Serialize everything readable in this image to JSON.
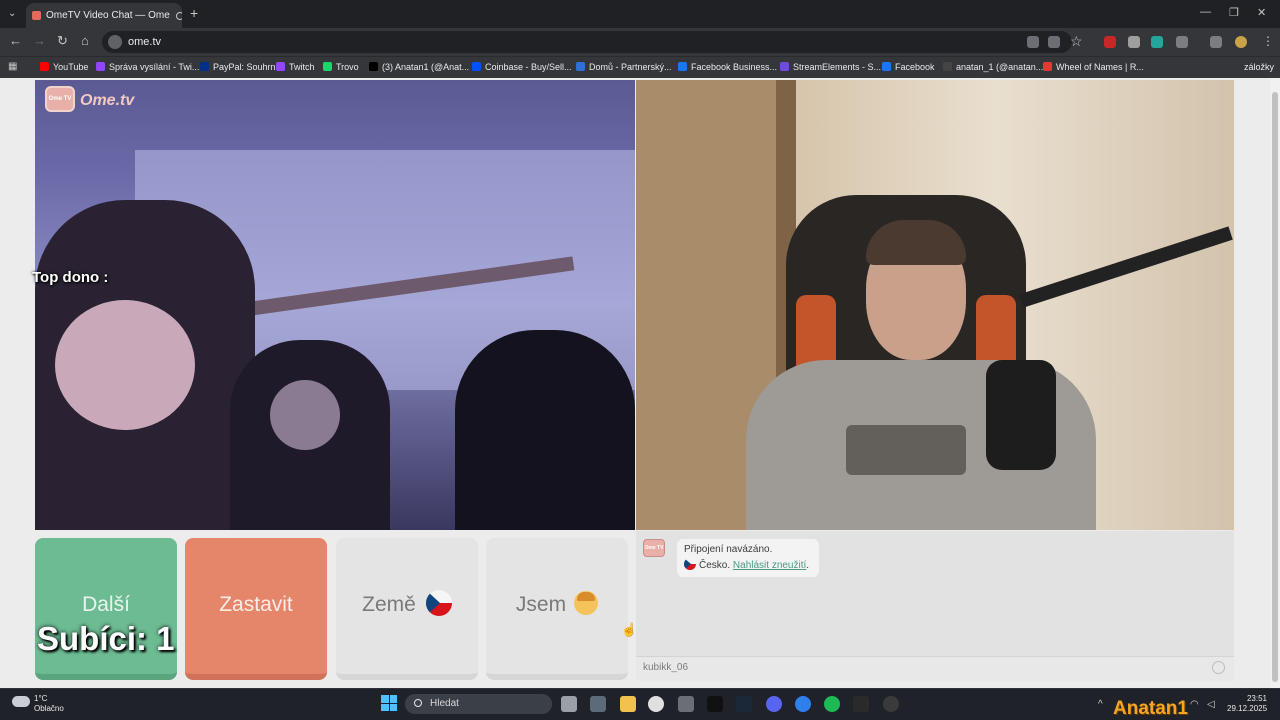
{
  "browser": {
    "tab_title": "OmeTV Video Chat — Ome",
    "url": "ome.tv",
    "bookmarks": [
      {
        "label": "YouTube",
        "color": "#ff0000"
      },
      {
        "label": "Správa vysílání - Twi...",
        "color": "#9146ff"
      },
      {
        "label": "PayPal: Souhrn",
        "color": "#003087"
      },
      {
        "label": "Twitch",
        "color": "#9146ff"
      },
      {
        "label": "Trovo",
        "color": "#19d66b"
      },
      {
        "label": "(3) Anatan1 (@Anat...",
        "color": "#000000"
      },
      {
        "label": "Coinbase - Buy/Sell...",
        "color": "#0052ff"
      },
      {
        "label": "Domů - Partnerský...",
        "color": "#2f6fd6"
      },
      {
        "label": "Facebook Business...",
        "color": "#1877f2"
      },
      {
        "label": "StreamElements - S...",
        "color": "#6e4bd8"
      },
      {
        "label": "Facebook",
        "color": "#1877f2"
      },
      {
        "label": "anatan_1 (@anatan...",
        "color": "#444444"
      },
      {
        "label": "Wheel of Names | R...",
        "color": "#e53935"
      }
    ],
    "bookmarks_overflow": "záložky"
  },
  "ometv": {
    "logo_text": "Ome.tv",
    "logo_badge": "Ome TV",
    "overlay_top_dono": "Top dono :",
    "buttons": {
      "next": "Další",
      "stop": "Zastavit",
      "country": "Země",
      "gender": "Jsem"
    },
    "overlay_subs": "Subíci: 1",
    "chat": {
      "line1": "Připojení navázáno.",
      "country": "Česko.",
      "report_link": "Nahlásit zneužití",
      "period": ".",
      "input_username": "kubikk_06"
    }
  },
  "taskbar": {
    "weather_temp": "1°C",
    "weather_desc": "Oblačno",
    "search_placeholder": "Hledat",
    "time": "23:51",
    "date": "29.12.2025",
    "watermark": "Anatan1"
  },
  "colors": {
    "next_button": "#6dbb93",
    "stop_button": "#e5866b",
    "accent_link": "#4a9a86"
  }
}
